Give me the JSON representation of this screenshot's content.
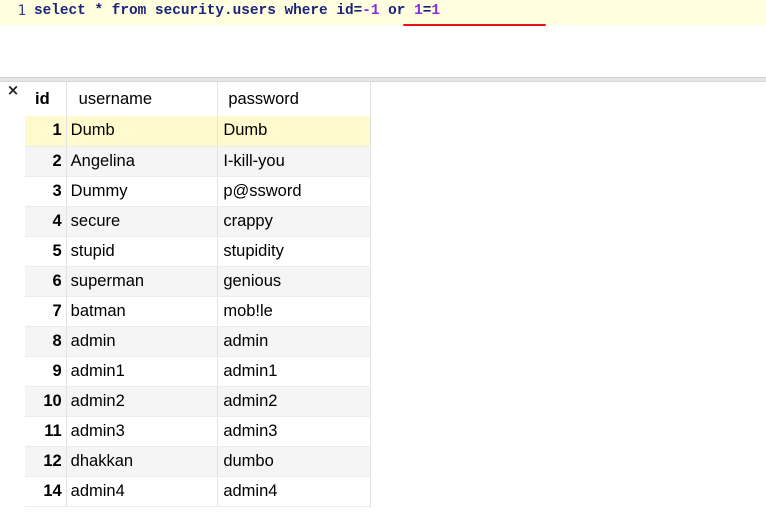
{
  "editor": {
    "line_number": "1",
    "tokens": {
      "select": "select",
      "star": " * ",
      "from": "from",
      "table": " security.users ",
      "where": "where",
      "space": " ",
      "cond_field": "id=",
      "cond_num1": "-1",
      "or_kw": " or ",
      "cond_num2": "1",
      "eq": "=",
      "cond_num3": "1"
    }
  },
  "results": {
    "close_glyph": "×",
    "columns": {
      "id": "id",
      "username": "username",
      "password": "password"
    },
    "rows": [
      {
        "id": "1",
        "username": "Dumb",
        "password": "Dumb"
      },
      {
        "id": "2",
        "username": "Angelina",
        "password": "I-kill-you"
      },
      {
        "id": "3",
        "username": "Dummy",
        "password": "p@ssword"
      },
      {
        "id": "4",
        "username": "secure",
        "password": "crappy"
      },
      {
        "id": "5",
        "username": "stupid",
        "password": "stupidity"
      },
      {
        "id": "6",
        "username": "superman",
        "password": "genious"
      },
      {
        "id": "7",
        "username": "batman",
        "password": "mob!le"
      },
      {
        "id": "8",
        "username": "admin",
        "password": "admin"
      },
      {
        "id": "9",
        "username": "admin1",
        "password": "admin1"
      },
      {
        "id": "10",
        "username": "admin2",
        "password": "admin2"
      },
      {
        "id": "11",
        "username": "admin3",
        "password": "admin3"
      },
      {
        "id": "12",
        "username": "dhakkan",
        "password": "dumbo"
      },
      {
        "id": "14",
        "username": "admin4",
        "password": "admin4"
      }
    ]
  },
  "colors": {
    "current_line": "#ffffe0",
    "selected_row": "#fffacd",
    "underline": "#e8141b",
    "keyword": "#1a237e",
    "number": "#8a2be2"
  }
}
